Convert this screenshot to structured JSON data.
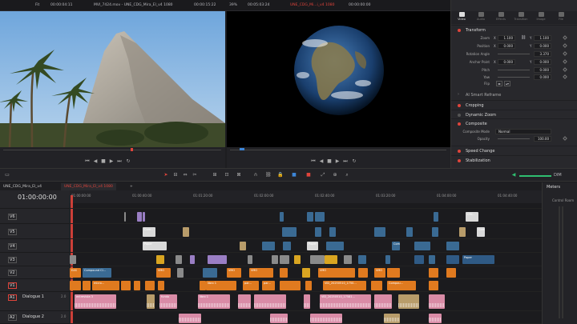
{
  "topbar": {
    "fit_left": "Fit",
    "tc_left": "00:00:04:11",
    "clip_left": "MVI_7424.mov - UNE_CDG_Mira_El_v4 1080",
    "tc_left2": "00:00:15:22",
    "zoom_right": "39%",
    "tc_right": "00:05:03:24",
    "timeline_right": "UNE_CDG_Mi...i_v4 1080",
    "tc_right2": "00:00:00:00",
    "inspector_clip": "MVI_7349.MOV"
  },
  "inspector": {
    "tabs": [
      "Video",
      "Audio",
      "Effects",
      "Transition",
      "Image",
      "File"
    ],
    "transform": {
      "title": "Transform",
      "zoom_label": "Zoom",
      "zoom_x": "1.100",
      "zoom_y": "1.100",
      "position_label": "Position",
      "position_x": "0.000",
      "position_y": "0.000",
      "rotation_label": "Rotation Angle",
      "rotation": "3.370",
      "anchor_label": "Anchor Point",
      "anchor_x": "0.000",
      "anchor_y": "0.000",
      "pitch_label": "Pitch",
      "pitch": "0.000",
      "yaw_label": "Yaw",
      "yaw": "0.000",
      "flip_label": "Flip"
    },
    "ai_reframe": "AI Smart Reframe",
    "cropping": "Cropping",
    "dynamic_zoom": "Dynamic Zoom",
    "composite": {
      "title": "Composite",
      "mode_label": "Composite Mode",
      "mode": "Normal",
      "opacity_label": "Opacity",
      "opacity": "100.00"
    },
    "speed_change": "Speed Change",
    "stabilization": "Stabilization"
  },
  "toolbar": {
    "dim": "DIM"
  },
  "timeline_tabs": [
    "UNE_CDG_Mira_El_v4",
    "UNE_CDG_Mira_El_v4 1080"
  ],
  "timecode": "01:00:00:00",
  "ruler": [
    "01:00:00:00",
    "01:00:40:00",
    "01:01:20:00",
    "01:02:00:00",
    "01:02:40:00",
    "01:03:20:00",
    "01:04:00:00",
    "01:04:40:00",
    "01:05:20:00"
  ],
  "tracks": {
    "v6": "V6",
    "v5": "V5",
    "v4": "V4",
    "v3": "V3",
    "v2": "V2",
    "v1": "V1",
    "a1": "A1",
    "a1_name": "Dialogue 1",
    "a2": "A2",
    "a2_name": "Dialogue 2",
    "a_level": "2.0"
  },
  "clip_labels": {
    "compound_short": "Com...",
    "paper": "Paper",
    "vmo": "VMO",
    "eas": "EAS",
    "compound_cl": "Compound Cl...",
    "micro": "micro...",
    "libro1": "libro 1",
    "par": "par...",
    "vid_long": "VID_20250510_1750...",
    "compo": "Compou...",
    "entrevista": "entrevista 3",
    "vid_a1": "VID_20250510_17581...",
    "fundo": "fundo",
    "crc": "CRC..."
  },
  "meters": {
    "title": "Meters",
    "room": "Control Room"
  },
  "colors": {
    "accent": "#e0443b",
    "video_clip": "#3a6a93",
    "audio_clip": "#d98ba6",
    "orange_clip": "#e07a1f",
    "purple_clip": "#9a7ec4"
  }
}
